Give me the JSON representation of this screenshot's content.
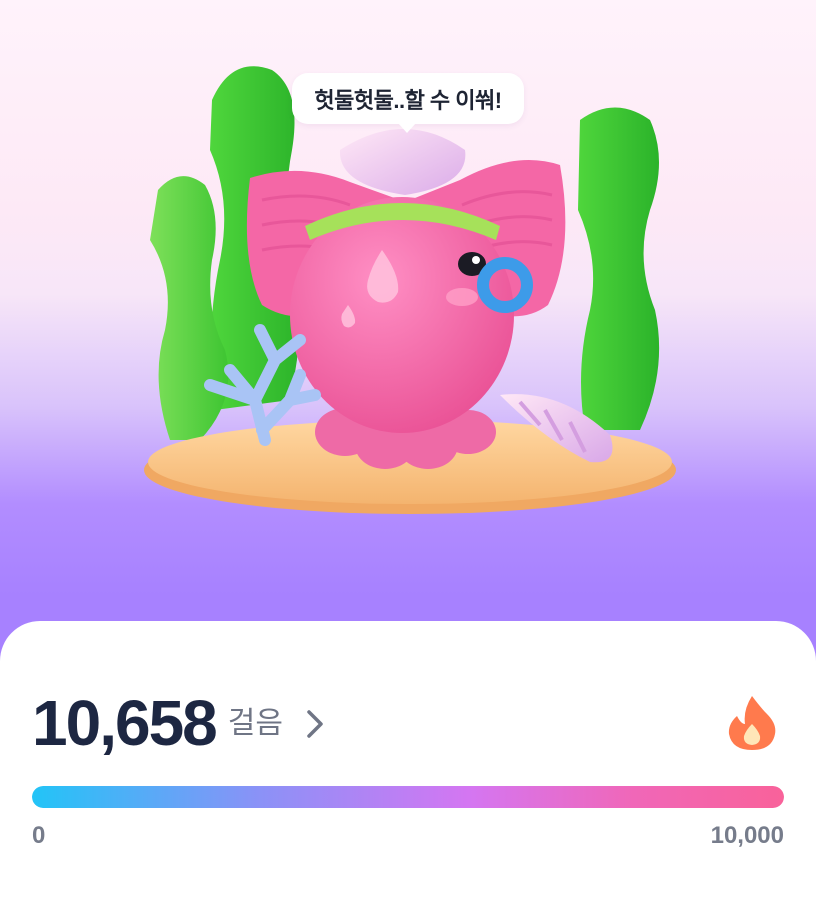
{
  "character": {
    "speech": "헛둘헛둘..할 수 이쒀!"
  },
  "steps": {
    "count": "10,658",
    "unit": "걸음"
  },
  "progress": {
    "min_label": "0",
    "max_label": "10,000",
    "fraction": 1.0
  },
  "icons": {
    "detail": "chevron-right-icon",
    "streak": "flame-icon"
  },
  "colors": {
    "count_text": "#1d2742",
    "flame": "#ff7a4d",
    "bar_start": "#22c4f7",
    "bar_end": "#f9629a"
  }
}
